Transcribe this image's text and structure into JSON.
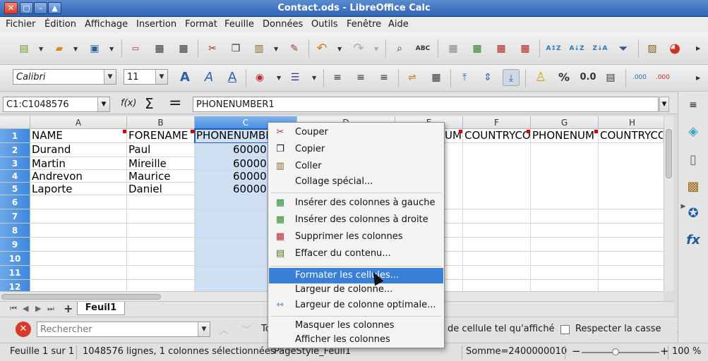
{
  "window": {
    "title": "Contact.ods - LibreOffice Calc"
  },
  "menubar": [
    "Fichier",
    "Édition",
    "Affichage",
    "Insertion",
    "Format",
    "Feuille",
    "Données",
    "Outils",
    "Fenêtre",
    "Aide"
  ],
  "toolbar": {
    "font_name": "Calibri",
    "font_size": "11",
    "percent": "%",
    "decimal": "0.0",
    "dec_add": ".000",
    "dec_remove": ".000"
  },
  "formula_bar": {
    "name_box": "C1:C1048576",
    "fx": "f(x)",
    "sum": "Σ",
    "equals": "=",
    "content": "PHONENUMBER1"
  },
  "grid": {
    "columns": [
      "A",
      "B",
      "C",
      "D",
      "E",
      "F",
      "G",
      "H"
    ],
    "rows": [
      "1",
      "2",
      "3",
      "4",
      "5",
      "6",
      "7",
      "8",
      "9",
      "10",
      "11",
      "12"
    ],
    "row1": [
      "NAME",
      "FORENAME",
      "PHONENUMBE",
      "",
      "UM",
      "COUNTRYCO",
      "PHONENUM",
      "COUNTRYCO"
    ],
    "data": [
      [
        "Durand",
        "Paul",
        "60000"
      ],
      [
        "Martin",
        "Mireille",
        "60000"
      ],
      [
        "Andrevon",
        "Maurice",
        "60000"
      ],
      [
        "Laporte",
        "Daniel",
        "60000"
      ]
    ]
  },
  "sheet": {
    "tab": "Feuil1",
    "add": "+"
  },
  "findbar": {
    "placeholder": "Rechercher",
    "truncated_label": "To",
    "option_display": "de cellule tel qu'affiché",
    "option_case": "Respecter la casse"
  },
  "context_menu": [
    {
      "label": "Couper",
      "icon": "scissors-icon"
    },
    {
      "label": "Copier",
      "icon": "copy-icon"
    },
    {
      "label": "Coller",
      "icon": "paste-icon"
    },
    {
      "label": "Collage spécial...",
      "icon": ""
    },
    {
      "label": "Insérer des colonnes à gauche",
      "icon": "insert-columns-left-icon"
    },
    {
      "label": "Insérer des colonnes à droite",
      "icon": "insert-columns-right-icon"
    },
    {
      "label": "Supprimer les colonnes",
      "icon": "delete-columns-icon"
    },
    {
      "label": "Effacer du contenu...",
      "icon": "clear-contents-icon"
    },
    {
      "label": "Formater les cellules...",
      "icon": "",
      "highlighted": true
    },
    {
      "label": "Largeur de colonne...",
      "icon": ""
    },
    {
      "label": "Largeur de colonne optimale...",
      "icon": "optimal-width-icon"
    },
    {
      "label": "Masquer les colonnes",
      "icon": ""
    },
    {
      "label": "Afficher les colonnes",
      "icon": ""
    }
  ],
  "statusbar": {
    "sheet": "Feuille 1 sur 1",
    "selection": "1048576 lignes, 1 colonnes sélectionnées",
    "pagestyle": "PageStyle_Feuil1",
    "sum": "Somme=2400000010",
    "zoom": "100 %",
    "zoom_minus": "−",
    "zoom_plus": "+"
  },
  "colors": {
    "selection": "#cfe0f5",
    "accent": "#3a7fd7",
    "title_bar": "#3f72c2"
  }
}
